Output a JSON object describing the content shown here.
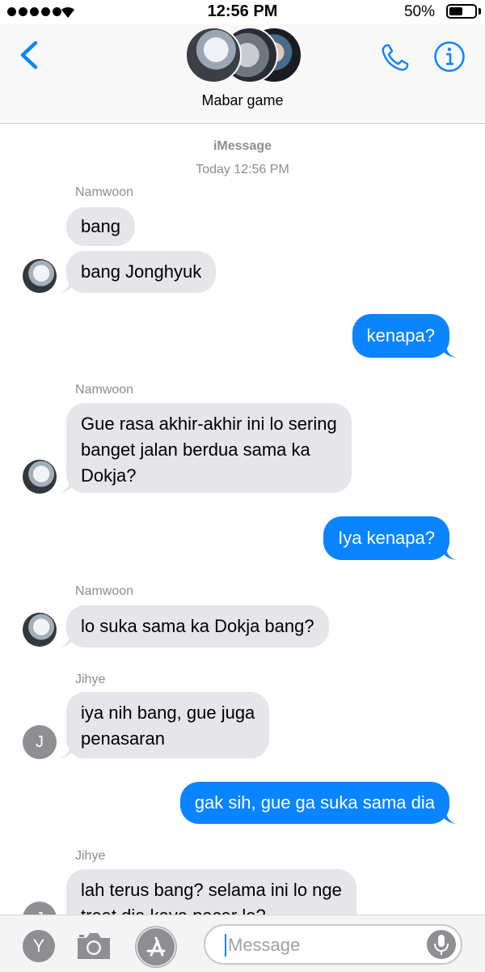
{
  "status_bar": {
    "time": "12:56 PM",
    "battery_percent": "50%",
    "battery_level": 0.5
  },
  "header": {
    "group_name": "Mabar game"
  },
  "thread": {
    "service_label": "iMessage",
    "timestamp": "Today 12:56 PM",
    "messages": [
      {
        "sender": "Namwoon",
        "direction": "incoming",
        "text": "bang"
      },
      {
        "sender": "Namwoon",
        "direction": "incoming",
        "text": "bang Jonghyuk"
      },
      {
        "sender": "me",
        "direction": "outgoing",
        "text": "kenapa?"
      },
      {
        "sender": "Namwoon",
        "direction": "incoming",
        "lines": [
          "Gue rasa akhir-akhir ini lo sering",
          "banget jalan berdua sama ka",
          "Dokja?"
        ]
      },
      {
        "sender": "me",
        "direction": "outgoing",
        "text": "Iya kenapa?"
      },
      {
        "sender": "Namwoon",
        "direction": "incoming",
        "text": "lo suka sama ka Dokja bang?"
      },
      {
        "sender": "Jihye",
        "direction": "incoming",
        "lines": [
          "iya nih bang, gue juga",
          "penasaran"
        ]
      },
      {
        "sender": "me",
        "direction": "outgoing",
        "text": "gak sih, gue ga suka sama dia"
      },
      {
        "sender": "Jihye",
        "direction": "incoming",
        "lines": [
          "lah terus bang? selama ini lo nge",
          "treat dia kaya pacar lo?"
        ]
      }
    ],
    "sender_labels": {
      "namwoon": "Namwoon",
      "jihye": "Jihye"
    },
    "avatar_initials": {
      "jihye": "J"
    }
  },
  "input_bar": {
    "contact_initial": "Y",
    "placeholder": "Message",
    "icons": [
      "camera-icon",
      "app-store-icon",
      "microphone-icon"
    ]
  },
  "colors": {
    "outgoing_bubble": "#0b84ff",
    "incoming_bubble": "#e5e5ea",
    "accent": "#0b84ff"
  }
}
